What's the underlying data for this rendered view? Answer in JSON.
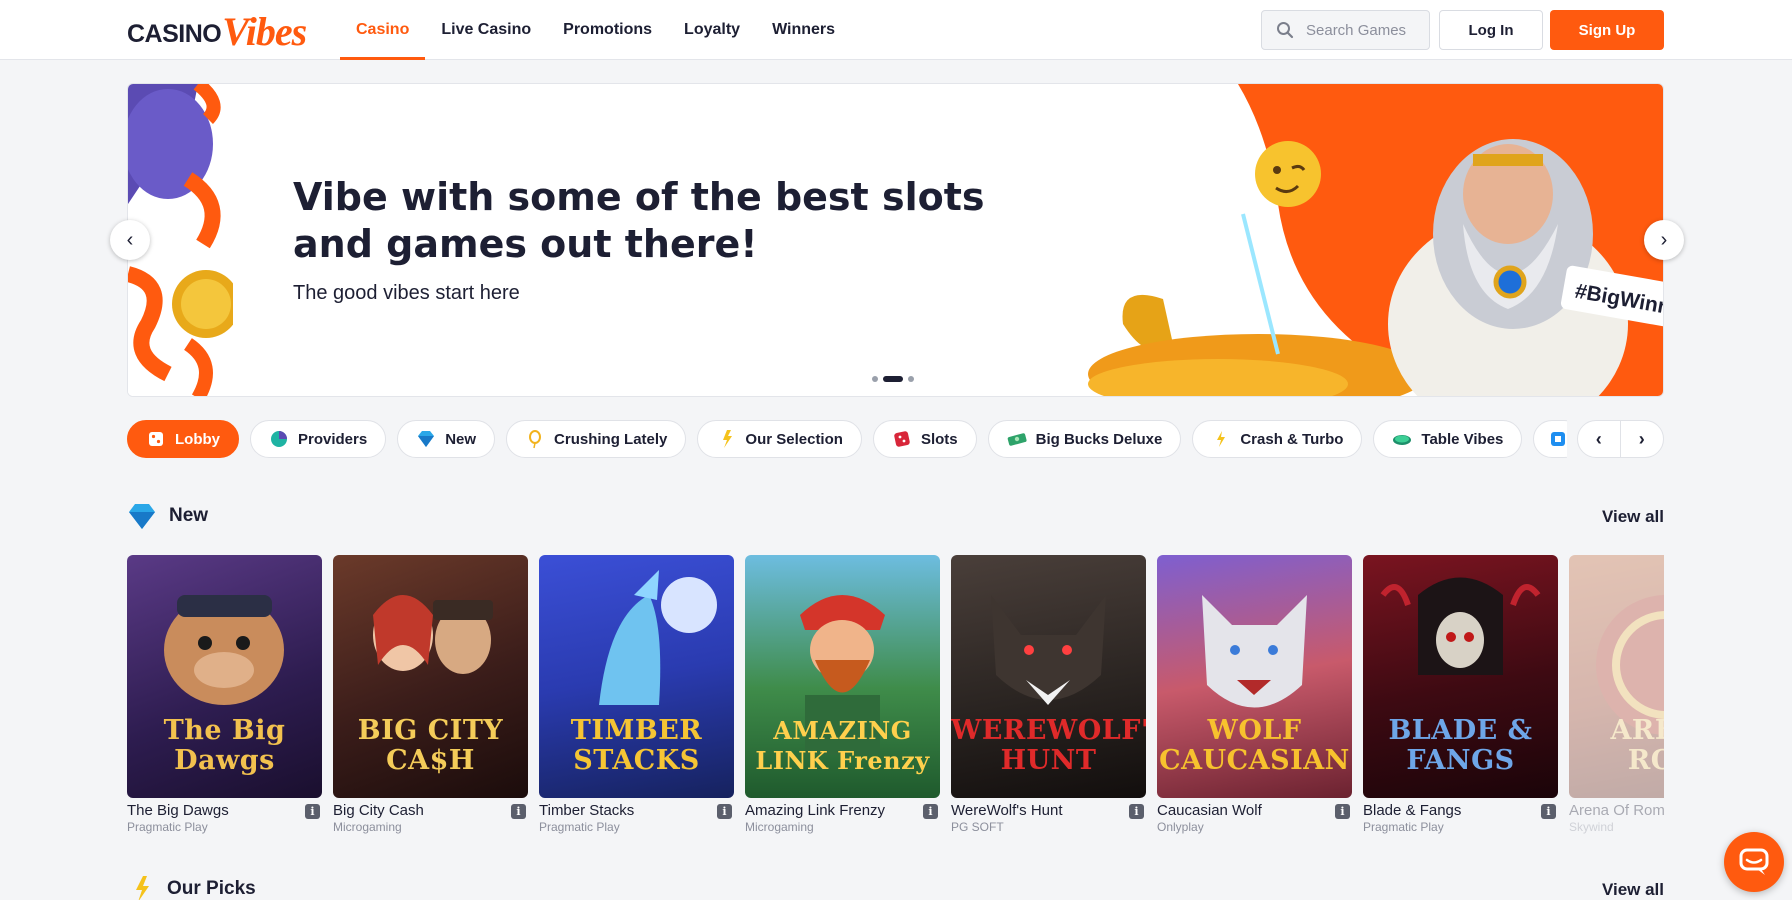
{
  "brand": {
    "part1": "CASINO",
    "part2": "Vibes"
  },
  "nav": [
    {
      "label": "Casino",
      "active": true
    },
    {
      "label": "Live Casino"
    },
    {
      "label": "Promotions"
    },
    {
      "label": "Loyalty"
    },
    {
      "label": "Winners"
    }
  ],
  "search": {
    "placeholder": "Search Games"
  },
  "auth": {
    "login": "Log In",
    "signup": "Sign Up"
  },
  "banner": {
    "title": "Vibe with some of the best slots and games out there!",
    "subtitle": "The good vibes start here",
    "tag": "#BigWinners",
    "slide_count": 3,
    "active_slide": 2
  },
  "categories": [
    {
      "label": "Lobby",
      "icon": "lobby-icon",
      "active": true
    },
    {
      "label": "Providers",
      "icon": "providers-icon"
    },
    {
      "label": "New",
      "icon": "diamond-icon"
    },
    {
      "label": "Crushing Lately",
      "icon": "balloon-icon"
    },
    {
      "label": "Our Selection",
      "icon": "star-icon"
    },
    {
      "label": "Slots",
      "icon": "dice-icon"
    },
    {
      "label": "Big Bucks Deluxe",
      "icon": "money-icon"
    },
    {
      "label": "Crash & Turbo",
      "icon": "lightning-icon"
    },
    {
      "label": "Table Vibes",
      "icon": "table-icon"
    }
  ],
  "sections": {
    "new": {
      "title": "New",
      "view_all": "View all"
    },
    "picks": {
      "title": "Our Picks",
      "view_all": "View all"
    }
  },
  "games": [
    {
      "name": "The Big Dawgs",
      "provider": "Pragmatic Play",
      "art": "The Big Dawgs"
    },
    {
      "name": "Big City Cash",
      "provider": "Microgaming",
      "art": "BIG CITY CA$H"
    },
    {
      "name": "Timber Stacks",
      "provider": "Pragmatic Play",
      "art": "TIMBER STACKS"
    },
    {
      "name": "Amazing Link Frenzy",
      "provider": "Microgaming",
      "art": "AMAZING LINK Frenzy"
    },
    {
      "name": "WereWolf's Hunt",
      "provider": "PG SOFT",
      "art": "WEREWOLF'S HUNT"
    },
    {
      "name": "Caucasian Wolf",
      "provider": "Onlyplay",
      "art": "WOLF CAUCASIAN"
    },
    {
      "name": "Blade & Fangs",
      "provider": "Pragmatic Play",
      "art": "BLADE & FANGS"
    },
    {
      "name": "Arena Of Rom",
      "provider": "Skywind",
      "art": "ARENA ROM"
    }
  ],
  "colors": {
    "accent": "#ff5a0f",
    "text": "#1d1f33",
    "muted": "#8c8f9c"
  }
}
